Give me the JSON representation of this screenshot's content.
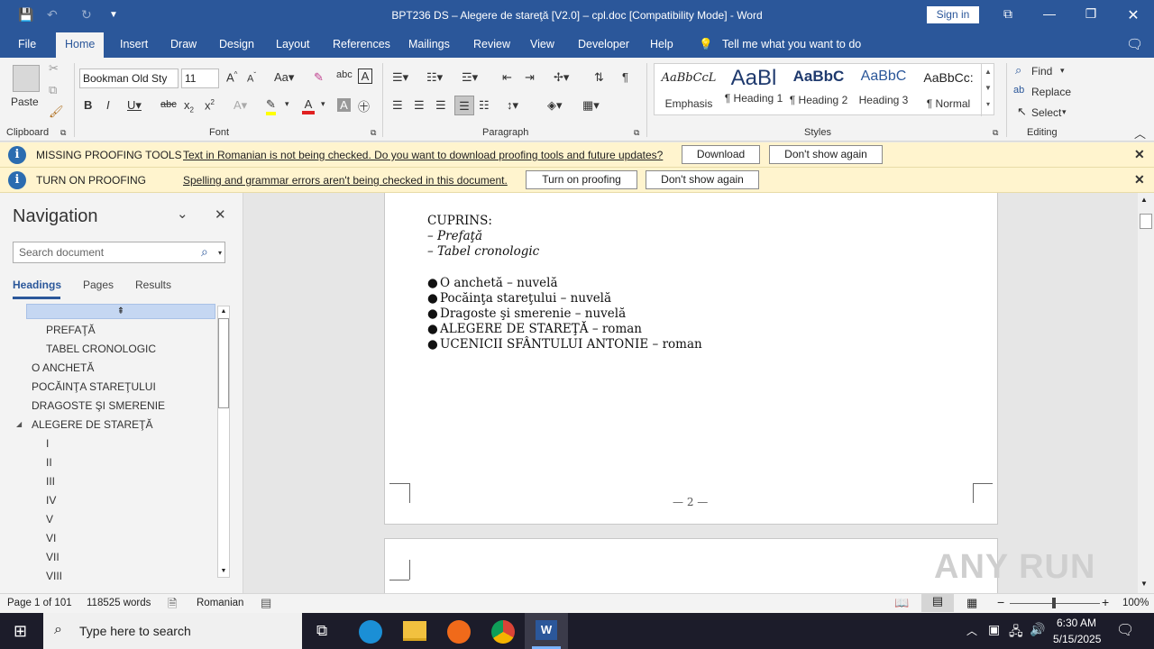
{
  "title": "BPT236 DS – Alegere de stareţă [V2.0] – cpl.doc [Compatibility Mode]  -  Word",
  "signin": "Sign in",
  "menus": [
    "File",
    "Home",
    "Insert",
    "Draw",
    "Design",
    "Layout",
    "References",
    "Mailings",
    "Review",
    "View",
    "Developer",
    "Help"
  ],
  "tell_me": "Tell me what you want to do",
  "clipboard": {
    "paste": "Paste",
    "label": "Clipboard"
  },
  "font": {
    "name": "Bookman Old Sty",
    "size": "11",
    "label": "Font"
  },
  "paragraph": {
    "label": "Paragraph"
  },
  "styles": {
    "label": "Styles",
    "items": [
      {
        "preview": "AaBbCcL",
        "name": "Emphasis"
      },
      {
        "preview": "AaBl",
        "name": "¶ Heading 1"
      },
      {
        "preview": "AaBbC",
        "name": "¶ Heading 2"
      },
      {
        "preview": "AaBbC",
        "name": "Heading 3"
      },
      {
        "preview": "AaBbCc:",
        "name": "¶ Normal"
      }
    ]
  },
  "editing": {
    "find": "Find",
    "replace": "Replace",
    "select": "Select",
    "label": "Editing"
  },
  "infobars": [
    {
      "title": "MISSING PROOFING TOOLS",
      "message": "Text in Romanian is not being checked. Do you want to download proofing tools and future updates?",
      "btn1": "Download",
      "btn2": "Don't show again"
    },
    {
      "title": "TURN ON PROOFING",
      "message": "Spelling and grammar errors aren't being checked in this document.",
      "btn1": "Turn on proofing",
      "btn2": "Don't show again"
    }
  ],
  "nav": {
    "title": "Navigation",
    "search_placeholder": "Search document",
    "tabs": [
      "Headings",
      "Pages",
      "Results"
    ],
    "items": [
      "PREFAŢĂ",
      "TABEL CRONOLOGIC",
      "O ANCHETĂ",
      "POCĂINŢA STAREŢULUI",
      "DRAGOSTE ŞI SMERENIE",
      "ALEGERE DE STAREŢĂ",
      "I",
      "II",
      "III",
      "IV",
      "V",
      "VI",
      "VII",
      "VIII"
    ]
  },
  "document": {
    "heading": "CUPRINS:",
    "dash_items": [
      "– Prefaţă",
      "– Tabel cronologic"
    ],
    "bullets": [
      "O anchetă – nuvelă",
      "Pocăinţa stareţului – nuvelă",
      "Dragoste şi smerenie – nuvelă",
      "ALEGERE DE STAREŢĂ – roman",
      "UCENICII SFÂNTULUI ANTONIE – roman"
    ],
    "page_number": "— 2 —"
  },
  "status": {
    "page": "Page 1 of 101",
    "words": "118525 words",
    "language": "Romanian",
    "zoom": "100%"
  },
  "taskbar": {
    "search": "Type here to search",
    "time": "6:30 AM",
    "date": "5/15/2025"
  },
  "watermark": "ANY RUN"
}
